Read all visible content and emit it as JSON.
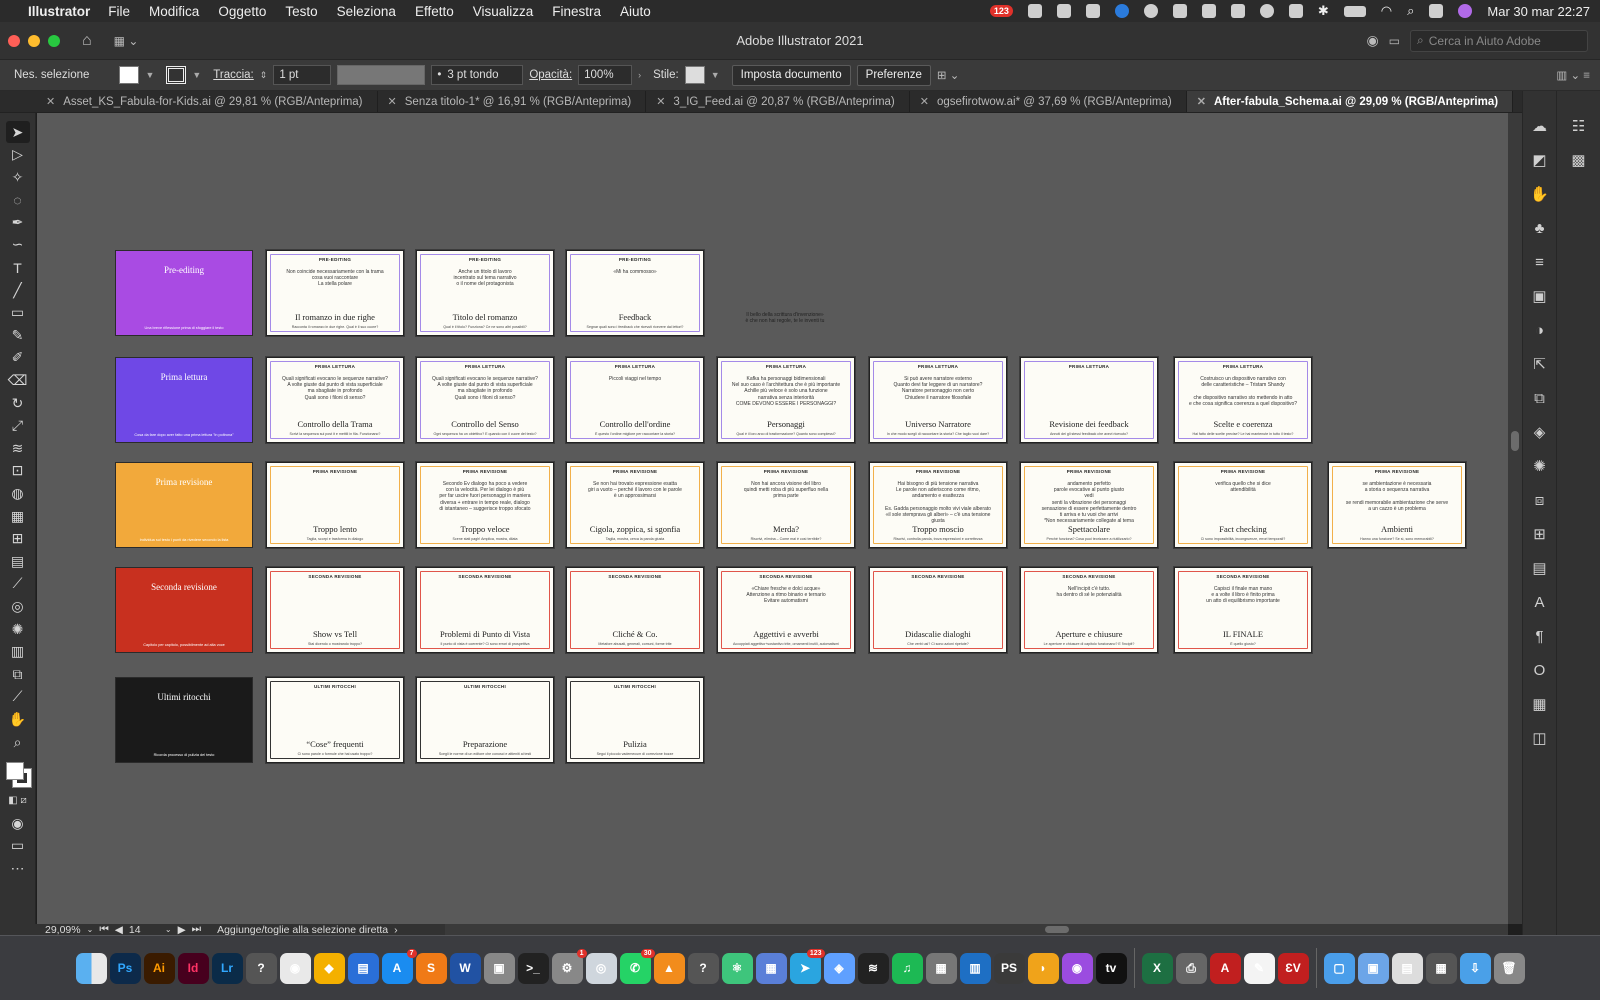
{
  "menubar": {
    "app_name": "Illustrator",
    "items": [
      "File",
      "Modifica",
      "Oggetto",
      "Testo",
      "Seleziona",
      "Effetto",
      "Visualizza",
      "Finestra",
      "Aiuto"
    ],
    "badge_count": "123",
    "datetime": "Mar 30 mar  22:27"
  },
  "window": {
    "title": "Adobe Illustrator 2021",
    "help_placeholder": "Cerca in Aiuto Adobe"
  },
  "control_bar": {
    "selection": "Nes. selezione",
    "stroke_label": "Traccia:",
    "stroke_value": "1 pt",
    "brush_value": "3 pt tondo",
    "opacity_label": "Opacità:",
    "opacity_value": "100%",
    "style_label": "Stile:",
    "doc_setup_button": "Imposta documento",
    "preferences_button": "Preferenze"
  },
  "tabs": [
    {
      "label": "Asset_KS_Fabula-for-Kids.ai @ 29,81 % (RGB/Anteprima)",
      "active": false
    },
    {
      "label": "Senza titolo-1* @ 16,91 % (RGB/Anteprima)",
      "active": false
    },
    {
      "label": "3_IG_Feed.ai @ 20,87 % (RGB/Anteprima)",
      "active": false
    },
    {
      "label": "ogsefirotwow.ai* @ 37,69 % (RGB/Anteprima)",
      "active": false
    },
    {
      "label": "After-fabula_Schema.ai @ 29,09 % (RGB/Anteprima)",
      "active": true
    }
  ],
  "statusbar": {
    "zoom": "29,09%",
    "artboard": "14",
    "info": "Aggiunge/toglie alla selezione diretta"
  },
  "canvas": {
    "free_text": [
      "Il bello della scrittura d'invenzione»",
      "è che non hai regole, te le inventi tu"
    ],
    "rows": [
      {
        "cover": {
          "title": "Pre-editing",
          "subtitle": "Una breve riflessione prima di sfoggiare il testo",
          "color": "#a94be3"
        },
        "border": "#a48ae8",
        "cards": [
          {
            "cat": "PRE-EDITING",
            "body": "Non coincide necessariamente con la trama\ncosa vuoi raccontare\nLa stella polare",
            "title": "Il romanzo in due righe",
            "sub": "Racconta il romanzo in due righe. Qual è il suo cuore?"
          },
          {
            "cat": "PRE-EDITING",
            "body": "Anche un titolo di lavoro\nincentrato sul tema narrativo\no il nome del protagonista",
            "title": "Titolo del romanzo",
            "sub": "Qual è il titolo? Funziona? Ce ne sono altri possibili?"
          },
          {
            "cat": "PRE-EDITING",
            "body": "«Mi ha commosso»",
            "title": "Feedback",
            "sub": "Segnar quali sono i feedback che ricevuti ricevere dai lettori?"
          }
        ]
      },
      {
        "cover": {
          "title": "Prima lettura",
          "subtitle": "Cosa da fare dopo aver fatto una prima lettura \"in poltrona\"",
          "color": "#6f48e6"
        },
        "border": "#a48ae8",
        "cards": [
          {
            "cat": "PRIMA LETTURA",
            "body": "Quali significati evocano le sequenze narrative?\nA volte giuste dal punto di vista superficiale\nma sbagliate in profondo\nQuali sono i filoni di senso?",
            "title": "Controllo della Trama",
            "sub": "Scrivi la sequenza sui post it e mettili in fila. Funzionano?"
          },
          {
            "cat": "PRIMA LETTURA",
            "body": "Quali significati evocano le sequenze narrative?\nA volte giuste dal punto di vista superficiale\nma sbagliate in profondo\nQuali sono i filoni di senso?",
            "title": "Controllo del Senso",
            "sub": "Ogni sequenza ha un obiettivo? E quando con il cuore del testo?"
          },
          {
            "cat": "PRIMA LETTURA",
            "body": "Piccoli viaggi nel tempo",
            "title": "Controllo dell'ordine",
            "sub": "È questo l'ordine migliore per raccontare la storia?"
          },
          {
            "cat": "PRIMA LETTURA",
            "body": "Kafka ha personaggi bidimensionali\nNel suo caso è l'architettura che è più importante\nAchille più veloce è solo una funzione\nnarrativa senza interiorità\nCOME DEVONO ESSERE I PERSONAGGI?",
            "title": "Personaggi",
            "sub": "Qual è il loro arco di trasformazione? Quanto sono complessi?"
          },
          {
            "cat": "PRIMA LETTURA",
            "body": "Si può avere narratore esterno\nQuanto devi far leggere di un narratore?\nNarratore personaggio non certo\nChiudere il narratore filosofale",
            "title": "Universo Narratore",
            "sub": "In che modo scegli di raccontare la storia? Che taglio vuoi dare?"
          },
          {
            "cat": "PRIMA LETTURA",
            "body": "",
            "title": "Revisione dei feedback",
            "sub": "Annoti dei gli stessi feedback che avevi ricevuto?"
          },
          {
            "cat": "PRIMA LETTURA",
            "body": "Costruisco un dispositivo narrativo con\ndelle caratteristiche – Tristam Shandy\n\nche dispositivo narrativo sto mettendo in atto\ne che cosa significa coerenza a quel dispositivo?",
            "title": "Scelte e coerenza",
            "sub": "Hai fatto delle scelte precise? Le hai mantenute in tutto il testo?"
          }
        ]
      },
      {
        "cover": {
          "title": "Prima revisione",
          "subtitle": "Individua sul testo i punti da rivedere secondo la lista",
          "color": "#f2a93b"
        },
        "border": "#f2b04a",
        "cards": [
          {
            "cat": "PRIMA REVISIONE",
            "body": "",
            "title": "Troppo lento",
            "sub": "Taglia, scorpi e trasforma in dialogo"
          },
          {
            "cat": "PRIMA REVISIONE",
            "body": "Secondo Ev dialogo ha poco a vedere\ncon la velocità. Per lei dialogo è più\nper far uscire fuori personaggi in maniera\ndiversa + entrare in tempo reale, dialogo\ndi istantaneo – suggerisce troppo sfocato",
            "title": "Troppo veloce",
            "sub": "Scene stati pagh! Amplica, mostra, dilata"
          },
          {
            "cat": "PRIMA REVISIONE",
            "body": "Se non hai trovato espressione esatta\ngiri a vuoto – perché il lavoro con le parole\nè un approssimarsi",
            "title": "Cigola, zoppica, si sgonfia",
            "sub": "Taglia, mostra, cerca la parola giusta"
          },
          {
            "cat": "PRIMA REVISIONE",
            "body": "Non hai ancora visione del libro\nquindi metti roba di più superfluo nella\nprima parte",
            "title": "Merda?",
            "sub": "Riscrivi, elimina – Come mai è così terribile?"
          },
          {
            "cat": "PRIMA REVISIONE",
            "body": "Hai bisogno di più tensione narrativa\nLe parole non aderiscono come ritmo,\nandamento e esattezza\n\nEs. Gadda personaggio molto vivi viale alberato\n«il sole stemprava gli alberi» – c'è una tensione giusta",
            "title": "Troppo moscio",
            "sub": "Riscrivi, controlla parola, trova espressioni e correttezza"
          },
          {
            "cat": "PRIMA REVISIONE",
            "body": "andamento perfetto\nparole evocative al punto giusto\nvedi\nsenti la vibrazione dei personaggi\nsensazione di essere perfettamente dentro\nti arriva e tu vuoi che arrivi\n*Non necessariamente collegate al tema",
            "title": "Spettacolare",
            "sub": "Perché funziona? Cosa puoi teorizzare a riutilizzarlo?"
          },
          {
            "cat": "PRIMA REVISIONE",
            "body": "verifica quello che si dice\nattendibilità",
            "title": "Fact checking",
            "sub": "Ci sono impossibilità, incongruenze, errori temporali?"
          },
          {
            "cat": "PRIMA REVISIONE",
            "body": "se ambientazione è necessaria\na storia o sequenza narrativa\n\nse rendi memorabile ambientazione che serve\na un cazzo è un problema",
            "title": "Ambienti",
            "sub": "Hanno una funzione? Se sì, sono memorabili?"
          }
        ]
      },
      {
        "cover": {
          "title": "Seconda revisione",
          "subtitle": "Capitolo per capitolo, possibilmente ad alta voce",
          "color": "#c8301f"
        },
        "border": "#e0554a",
        "cards": [
          {
            "cat": "SECONDA REVISIONE",
            "body": "",
            "title": "Show vs Tell",
            "sub": "Stai dicendo o mostrando troppo?"
          },
          {
            "cat": "SECONDA REVISIONE",
            "body": "",
            "title": "Problemi di Punto di Vista",
            "sub": "Il punto di vista è coerente? Ci sono errori di prospettiva"
          },
          {
            "cat": "SECONDA REVISIONE",
            "body": "",
            "title": "Cliché & Co.",
            "sub": "Metafore abusati, generali, comuni, forme trite"
          },
          {
            "cat": "SECONDA REVISIONE",
            "body": "«Chiare fresche e dolci acque»\nAttenzione a ritmo binario e ternario\nEvitare automatismi",
            "title": "Aggettivi e avverbi",
            "sub": "Accoppiati aggettivo+sostantivo trite, ornamenti inutili, automatismi"
          },
          {
            "cat": "SECONDA REVISIONE",
            "body": "",
            "title": "Didascalie dialoghi",
            "sub": "Che verbi usi? Ci sono azioni ripetute?"
          },
          {
            "cat": "SECONDA REVISIONE",
            "body": "Nell'incipit c'è tutto.\nha dentro di sé le potenzialità",
            "title": "Aperture e chiusure",
            "sub": "Le aperture e chiusure di capitolo funzionano? E l'incipit?"
          },
          {
            "cat": "SECONDA REVISIONE",
            "body": "Capisci il finale man mano\ne a volte il libro è finito prima\nun atto di equilibrismo importante",
            "title": "IL FINALE",
            "sub": "È quello giusto?"
          }
        ]
      },
      {
        "cover": {
          "title": "Ultimi ritocchi",
          "subtitle": "Ricorda processo di pulizia del testo",
          "color": "#1a1a1a"
        },
        "border": "#333333",
        "cards": [
          {
            "cat": "ULTIMI RITOCCHI",
            "body": "",
            "title": "“Cose” frequenti",
            "sub": "Ci sono parole o formule che hai usato troppo?"
          },
          {
            "cat": "ULTIMI RITOCCHI",
            "body": "",
            "title": "Preparazione",
            "sub": "Scegli le norme di un editore che conosci e attieniti ai testi"
          },
          {
            "cat": "ULTIMI RITOCCHI",
            "body": "",
            "title": "Pulizia",
            "sub": "Segui il piccolo vademecum di correzione bozze"
          }
        ]
      }
    ]
  },
  "dock": {
    "apps": [
      "Finder",
      "Ps",
      "Ai",
      "Id",
      "Lr",
      "?",
      "Chrome",
      "Sketch",
      "Keynote",
      "App Store",
      "Sublime",
      "Word",
      "Preview",
      "Terminal",
      "Settings",
      "Safari",
      "WhatsApp",
      "VLC",
      "?",
      "Atom",
      "Screens",
      "Telegram",
      "Affinity",
      "Activity",
      "Spotify",
      "Calculator",
      "Trello",
      "PhpStorm",
      "Cyberduck",
      "Podcast",
      "TV",
      "Excel",
      "Print",
      "Acrobat",
      "TextEdit",
      "Express",
      "Folder",
      "Finder2",
      "Docs",
      "Notes",
      "Downloads",
      "Trash"
    ],
    "badges": {
      "Ai": "",
      "App Store": "7",
      "Settings": "1",
      "WhatsApp": "30",
      "Telegram": "123"
    }
  }
}
